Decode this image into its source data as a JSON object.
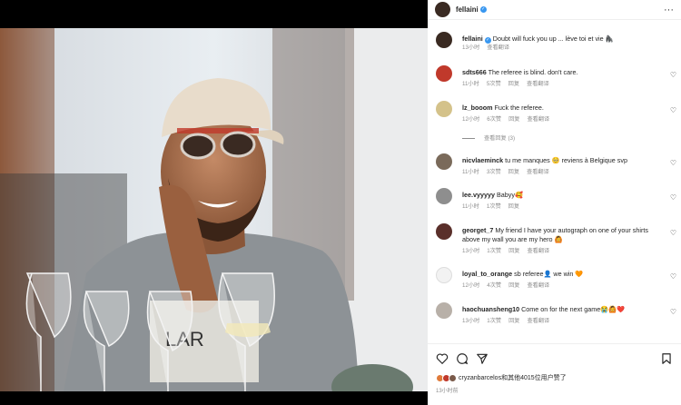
{
  "post": {
    "author": "fellaini",
    "caption": "Doubt will fuck you up ... lève toi et vie 🦍",
    "caption_time": "13小时"
  },
  "ui": {
    "reply": "回复",
    "translate": "查看翻译",
    "view_replies": "查看回复 (3)",
    "more": "···"
  },
  "comments": [
    {
      "user": "sdts666",
      "text": "The referee is blind. don't care.",
      "time": "11小时",
      "likes": "5次赞"
    },
    {
      "user": "lz_booom",
      "text": "Fuck the referee.",
      "time": "12小时",
      "likes": "6次赞"
    },
    {
      "user": "nicvlaeminck",
      "text": "tu me manques 🥺 reviens à Belgique svp",
      "time": "11小时",
      "likes": "3次赞"
    },
    {
      "user": "lee.vyyyyy",
      "text": "Babyy🥰",
      "time": "11小时",
      "likes": "1次赞"
    },
    {
      "user": "georget_7",
      "text": "My friend I have your autograph on one of your shirts above my wall you are my hero 🙆",
      "time": "13小时",
      "likes": "1次赞"
    },
    {
      "user": "loyal_to_orange",
      "text": "sb referee👤 we win 🧡",
      "time": "12小时",
      "likes": "4次赞"
    },
    {
      "user": "haochuansheng10",
      "text": "Come on for the next game😭🙆❤️",
      "time": "13小时",
      "likes": "1次赞"
    }
  ],
  "footer": {
    "likes_text": "cryzanbarcelos和其他4015位用户赞了",
    "time": "13小时前"
  },
  "colors": {
    "verified": "#3897f0",
    "meta_gray": "#8e8e8e",
    "text": "#262626"
  }
}
